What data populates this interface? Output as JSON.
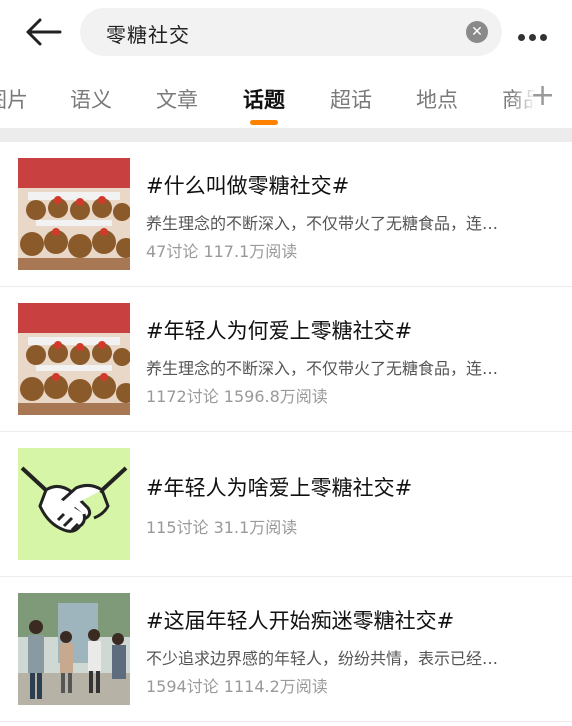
{
  "search": {
    "query": "零糖社交",
    "clear_icon": "clear-icon",
    "back_icon": "back-arrow-icon",
    "more_icon": "more-dots-icon"
  },
  "tabs": [
    {
      "label": "图片"
    },
    {
      "label": "语义"
    },
    {
      "label": "文章"
    },
    {
      "label": "话题",
      "active": true
    },
    {
      "label": "超话"
    },
    {
      "label": "地点"
    },
    {
      "label": "商品"
    }
  ],
  "tabs_plus_icon": "plus-icon",
  "accent_color": "#ff8200",
  "topics": [
    {
      "title": "#什么叫做零糖社交#",
      "desc": "养生理念的不断深入，不仅带火了无糖食品，连…",
      "stats": "47讨论 117.1万阅读",
      "thumb": "plush-toys-image"
    },
    {
      "title": "#年轻人为何爱上零糖社交#",
      "desc": "养生理念的不断深入，不仅带火了无糖食品，连…",
      "stats": "1172讨论 1596.8万阅读",
      "thumb": "plush-toys-image"
    },
    {
      "title": "#年轻人为啥爱上零糖社交#",
      "desc": "",
      "stats": "115讨论 31.1万阅读",
      "thumb": "handshake-image"
    },
    {
      "title": "#这届年轻人开始痴迷零糖社交#",
      "desc": "不少追求边界感的年轻人，纷纷共情，表示已经…",
      "stats": "1594讨论 1114.2万阅读",
      "thumb": "people-photo-image"
    }
  ]
}
